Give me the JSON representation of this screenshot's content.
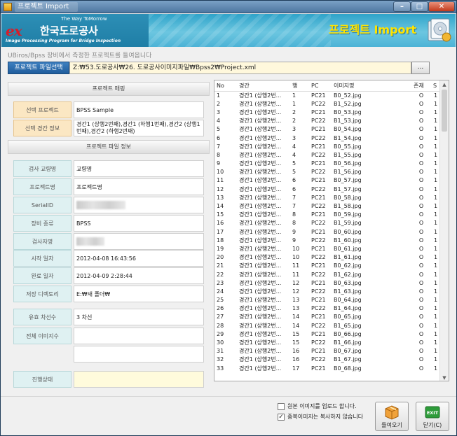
{
  "window": {
    "title": "프로젝트 Import",
    "min_label": "–",
    "max_label": "□",
    "close_label": "✕"
  },
  "banner": {
    "logo_mark": "ex",
    "corp_name": "한국도로공사",
    "slogan": "The Way ToMorrow",
    "subtitle": "Image Processing Program for Bridge Inspection",
    "heading": "프로젝트 Import"
  },
  "hint": "UBiros/Bpss 장비에서 측정한 프로젝트를 들여옵니다",
  "path": {
    "button_label": "프로젝트 파일선택",
    "value": "Z:₩53.도로공사₩26. 도로공사이미지파일₩Bpss2₩Project.xml",
    "browse_label": "..."
  },
  "mapping": {
    "header": "프로젝트 매핑",
    "project_label": "선택 프로젝트",
    "project_value": "BPSS Sample",
    "span_label": "선택 경간 정보",
    "span_value": "경간1 (상행2번째),경간1 (하행1번째),경간2 (상행1번째),경간2 (하행2번째)"
  },
  "fileinfo": {
    "header": "프로젝트 파일 정보",
    "fields": [
      {
        "label": "검사 교량명",
        "value": "교량명"
      },
      {
        "label": "프로젝트명",
        "value": "프로젝트명"
      },
      {
        "label": "SerialID",
        "value": ""
      },
      {
        "label": "장비 종류",
        "value": "BPSS"
      },
      {
        "label": "검사자명",
        "value": ""
      },
      {
        "label": "시작 일자",
        "value": "2012-04-08 16:43:56"
      },
      {
        "label": "완료 일자",
        "value": "2012-04-09 2:28:44"
      },
      {
        "label": "저장 디렉토리",
        "value": "E:₩새 폴더₩"
      },
      {
        "label": "유효 차선수",
        "value": "3 차선"
      },
      {
        "label": "전체 이미지수",
        "value": ""
      },
      {
        "label": "진행상태",
        "value": ""
      }
    ]
  },
  "grid": {
    "columns": [
      "No",
      "경간",
      "행",
      "PC",
      "이미지명",
      "존재",
      "S"
    ],
    "rows": [
      [
        "1",
        "경간1 (상행2번...",
        "1",
        "PC21",
        "B0_52.jpg",
        "O",
        "1"
      ],
      [
        "2",
        "경간1 (상행2번...",
        "1",
        "PC22",
        "B1_52.jpg",
        "O",
        "1"
      ],
      [
        "3",
        "경간1 (상행2번...",
        "2",
        "PC21",
        "B0_53.jpg",
        "O",
        "1"
      ],
      [
        "4",
        "경간1 (상행2번...",
        "2",
        "PC22",
        "B1_53.jpg",
        "O",
        "1"
      ],
      [
        "5",
        "경간1 (상행2번...",
        "3",
        "PC21",
        "B0_54.jpg",
        "O",
        "1"
      ],
      [
        "6",
        "경간1 (상행2번...",
        "3",
        "PC22",
        "B1_54.jpg",
        "O",
        "1"
      ],
      [
        "7",
        "경간1 (상행2번...",
        "4",
        "PC21",
        "B0_55.jpg",
        "O",
        "1"
      ],
      [
        "8",
        "경간1 (상행2번...",
        "4",
        "PC22",
        "B1_55.jpg",
        "O",
        "1"
      ],
      [
        "9",
        "경간1 (상행2번...",
        "5",
        "PC21",
        "B0_56.jpg",
        "O",
        "1"
      ],
      [
        "10",
        "경간1 (상행2번...",
        "5",
        "PC22",
        "B1_56.jpg",
        "O",
        "1"
      ],
      [
        "11",
        "경간1 (상행2번...",
        "6",
        "PC21",
        "B0_57.jpg",
        "O",
        "1"
      ],
      [
        "12",
        "경간1 (상행2번...",
        "6",
        "PC22",
        "B1_57.jpg",
        "O",
        "1"
      ],
      [
        "13",
        "경간1 (상행2번...",
        "7",
        "PC21",
        "B0_58.jpg",
        "O",
        "1"
      ],
      [
        "14",
        "경간1 (상행2번...",
        "7",
        "PC22",
        "B1_58.jpg",
        "O",
        "1"
      ],
      [
        "15",
        "경간1 (상행2번...",
        "8",
        "PC21",
        "B0_59.jpg",
        "O",
        "1"
      ],
      [
        "16",
        "경간1 (상행2번...",
        "8",
        "PC22",
        "B1_59.jpg",
        "O",
        "1"
      ],
      [
        "17",
        "경간1 (상행2번...",
        "9",
        "PC21",
        "B0_60.jpg",
        "O",
        "1"
      ],
      [
        "18",
        "경간1 (상행2번...",
        "9",
        "PC22",
        "B1_60.jpg",
        "O",
        "1"
      ],
      [
        "19",
        "경간1 (상행2번...",
        "10",
        "PC21",
        "B0_61.jpg",
        "O",
        "1"
      ],
      [
        "20",
        "경간1 (상행2번...",
        "10",
        "PC22",
        "B1_61.jpg",
        "O",
        "1"
      ],
      [
        "21",
        "경간1 (상행2번...",
        "11",
        "PC21",
        "B0_62.jpg",
        "O",
        "1"
      ],
      [
        "22",
        "경간1 (상행2번...",
        "11",
        "PC22",
        "B1_62.jpg",
        "O",
        "1"
      ],
      [
        "23",
        "경간1 (상행2번...",
        "12",
        "PC21",
        "B0_63.jpg",
        "O",
        "1"
      ],
      [
        "24",
        "경간1 (상행2번...",
        "12",
        "PC22",
        "B1_63.jpg",
        "O",
        "1"
      ],
      [
        "25",
        "경간1 (상행2번...",
        "13",
        "PC21",
        "B0_64.jpg",
        "O",
        "1"
      ],
      [
        "26",
        "경간1 (상행2번...",
        "13",
        "PC22",
        "B1_64.jpg",
        "O",
        "1"
      ],
      [
        "27",
        "경간1 (상행2번...",
        "14",
        "PC21",
        "B0_65.jpg",
        "O",
        "1"
      ],
      [
        "28",
        "경간1 (상행2번...",
        "14",
        "PC22",
        "B1_65.jpg",
        "O",
        "1"
      ],
      [
        "29",
        "경간1 (상행2번...",
        "15",
        "PC21",
        "B0_66.jpg",
        "O",
        "1"
      ],
      [
        "30",
        "경간1 (상행2번...",
        "15",
        "PC22",
        "B1_66.jpg",
        "O",
        "1"
      ],
      [
        "31",
        "경간1 (상행2번...",
        "16",
        "PC21",
        "B0_67.jpg",
        "O",
        "1"
      ],
      [
        "32",
        "경간1 (상행2번...",
        "16",
        "PC22",
        "B1_67.jpg",
        "O",
        "1"
      ],
      [
        "33",
        "경간1 (상행2번...",
        "17",
        "PC21",
        "B0_68.jpg",
        "O",
        "1"
      ]
    ]
  },
  "options": {
    "upload_original": {
      "label": "원본 이미지를 업로드 합니다.",
      "checked": false
    },
    "skip_duplicate": {
      "label": "중복이미지는 복사하지 않습니다",
      "checked": true
    }
  },
  "buttons": {
    "import_label": "들여오기",
    "exit_label": "닫기(C)",
    "exit_icon_text": "EXIT"
  },
  "colors": {
    "banner": "#4cb3d6",
    "heading": "#ffe400",
    "path_button": "#2a6fb0",
    "orange_label": "#fbe7c3",
    "teal_label": "#dff1f2",
    "cream_field": "#fff8dc"
  }
}
